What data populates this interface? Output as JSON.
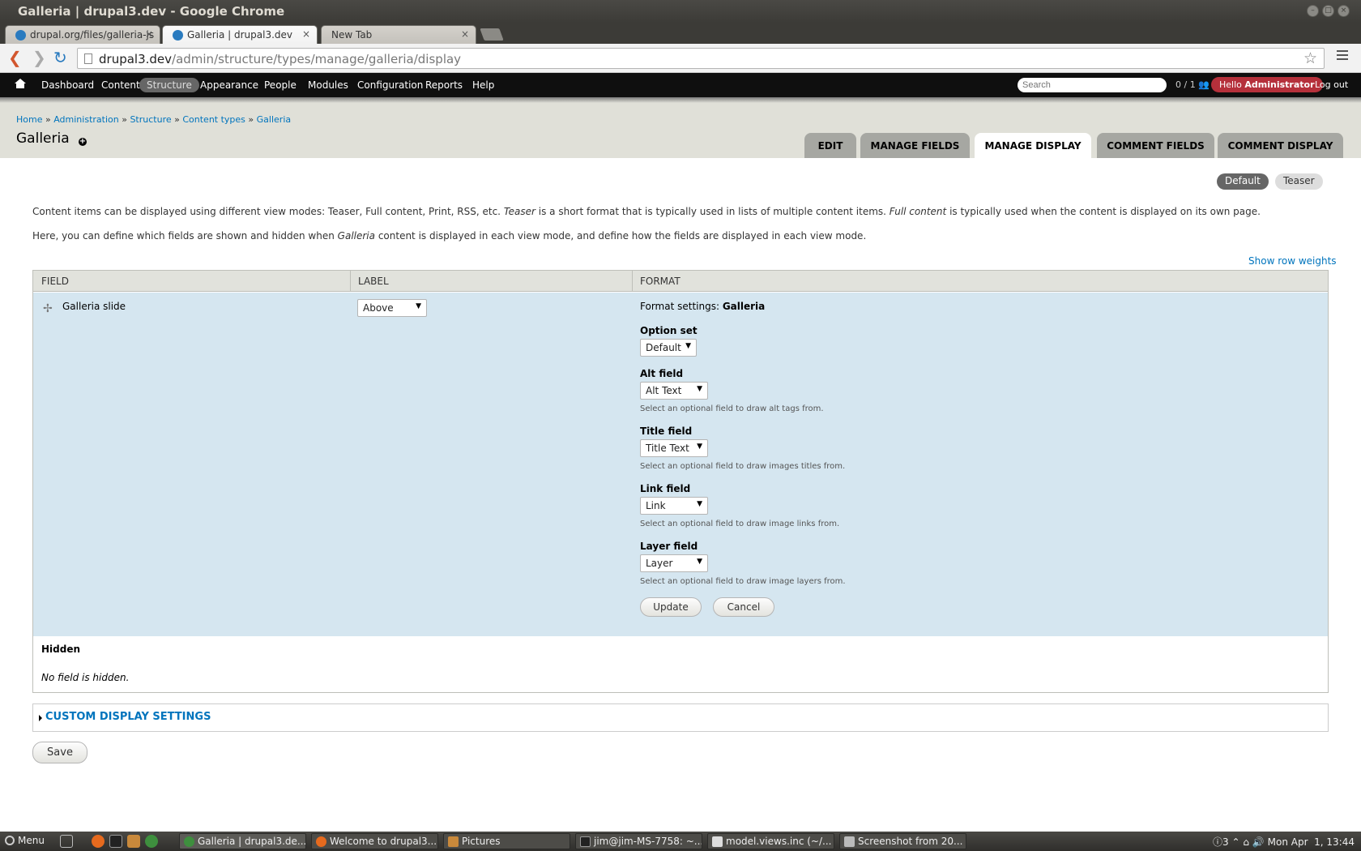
{
  "window": {
    "title": "Galleria | drupal3.dev - Google Chrome"
  },
  "browser_tabs": [
    {
      "label": "drupal.org/files/galleria-js",
      "active": false
    },
    {
      "label": "Galleria | drupal3.dev",
      "active": true
    },
    {
      "label": "New Tab",
      "active": false
    }
  ],
  "address_bar": {
    "host": "drupal3.dev",
    "path": "/admin/structure/types/manage/galleria/display"
  },
  "drupal_toolbar": {
    "items": [
      "Dashboard",
      "Content",
      "Structure",
      "Appearance",
      "People",
      "Modules",
      "Configuration",
      "Reports",
      "Help"
    ],
    "active_item": "Structure",
    "search_placeholder": "Search",
    "user_count": "0 / 1",
    "hello_prefix": "Hello",
    "hello_user": "Administrator",
    "logout": "Log out"
  },
  "breadcrumb": {
    "items": [
      "Home",
      "Administration",
      "Structure",
      "Content types",
      "Galleria"
    ],
    "separator": "»"
  },
  "page_title": "Galleria",
  "primary_tabs": [
    {
      "label": "EDIT",
      "active": false
    },
    {
      "label": "MANAGE FIELDS",
      "active": false
    },
    {
      "label": "MANAGE DISPLAY",
      "active": true
    },
    {
      "label": "COMMENT FIELDS",
      "active": false
    },
    {
      "label": "COMMENT DISPLAY",
      "active": false
    }
  ],
  "view_modes": {
    "default": "Default",
    "teaser": "Teaser",
    "active": "Default"
  },
  "description": {
    "line1_a": "Content items can be displayed using different view modes: Teaser, Full content, Print, RSS, etc. ",
    "line1_em1": "Teaser",
    "line1_b": " is a short format that is typically used in lists of multiple content items. ",
    "line1_em2": "Full content",
    "line1_c": " is typically used when the content is displayed on its own page.",
    "line2_a": "Here, you can define which fields are shown and hidden when ",
    "line2_em": "Galleria",
    "line2_b": " content is displayed in each view mode, and define how the fields are displayed in each view mode."
  },
  "show_row_weights": "Show row weights",
  "table": {
    "headers": [
      "FIELD",
      "LABEL",
      "FORMAT"
    ],
    "row": {
      "field": "Galleria slide",
      "label_select": "Above",
      "format_settings_prefix": "Format settings:",
      "format_settings_name": "Galleria",
      "settings": [
        {
          "label": "Option set",
          "value": "Default",
          "help": ""
        },
        {
          "label": "Alt field",
          "value": "Alt Text",
          "help": "Select an optional field to draw alt tags from."
        },
        {
          "label": "Title field",
          "value": "Title Text",
          "help": "Select an optional field to draw images titles from."
        },
        {
          "label": "Link field",
          "value": "Link",
          "help": "Select an optional field to draw image links from."
        },
        {
          "label": "Layer field",
          "value": "Layer",
          "help": "Select an optional field to draw image layers from."
        }
      ],
      "update_button": "Update",
      "cancel_button": "Cancel"
    },
    "hidden_region": "Hidden",
    "no_hidden": "No field is hidden."
  },
  "custom_display_settings": "CUSTOM DISPLAY SETTINGS",
  "save_button": "Save",
  "taskbar": {
    "menu": "Menu",
    "tasks": [
      {
        "label": "Galleria | drupal3.de...",
        "active": true
      },
      {
        "label": "Welcome to drupal3....",
        "active": false
      },
      {
        "label": "Pictures",
        "active": false
      },
      {
        "label": "jim@jim-MS-7758: ~...",
        "active": false
      },
      {
        "label": "model.views.inc (~/...",
        "active": false
      },
      {
        "label": "Screenshot from 20...",
        "active": false
      }
    ],
    "tray_count": "3",
    "clock": "Mon Apr  1, 13:44"
  }
}
